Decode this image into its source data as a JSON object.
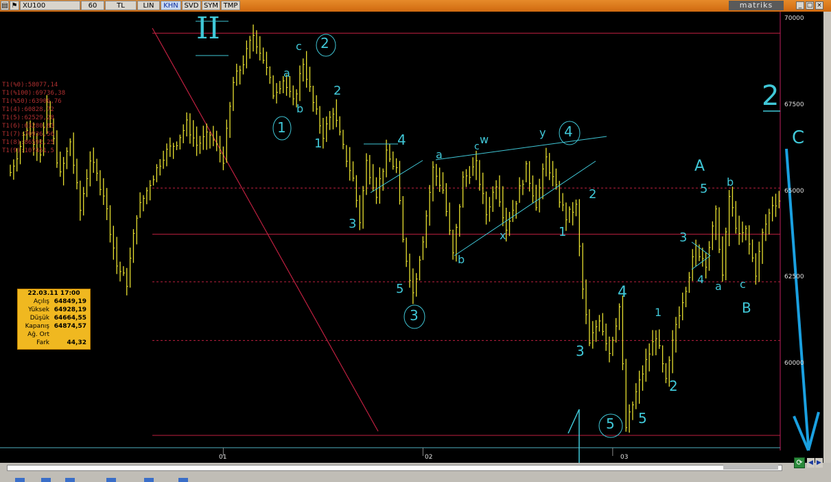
{
  "toolbar": {
    "symbol": "XU100",
    "period": "60",
    "currency": "TL",
    "scale": "LIN",
    "buttons": [
      "KHN",
      "SVD",
      "SYM",
      "TMP"
    ],
    "brand": "matriks"
  },
  "fib_levels": [
    "T1(%0):58077,14",
    "T1(%100):69736,38",
    "T1(%50):63906,76",
    "T1(4):60828,72",
    "T1(5):62529,28",
    "T1(6):63280,83",
    "T1(7):76936,56",
    "T1(8):86592,25",
    "T1(9):107451,5"
  ],
  "ohlc_box": {
    "date": "22.03.11 17:00",
    "rows": [
      {
        "label": "Açılış",
        "value": "64849,19"
      },
      {
        "label": "Yüksek",
        "value": "64928,19"
      },
      {
        "label": "Düşük",
        "value": "64664,55"
      },
      {
        "label": "Kapanış",
        "value": "64874,57"
      },
      {
        "label": "Ağ. Ort",
        "value": ""
      },
      {
        "label": "Fark",
        "value": "44,32"
      }
    ]
  },
  "chart_data": {
    "type": "bar",
    "title": "",
    "xlabel": "",
    "ylabel": "",
    "ylim": [
      57500,
      70500
    ],
    "yticks": [
      60000,
      62500,
      65000,
      67500,
      70000
    ],
    "ytick_labels": [
      "60000",
      "62500",
      "65000",
      "67500",
      "70000"
    ],
    "xticks": [
      {
        "label": "01",
        "index": 64
      },
      {
        "label": "02",
        "index": 124
      },
      {
        "label": "03",
        "index": 181
      }
    ],
    "grid": false,
    "legend": "none",
    "colors": {
      "bars": "#e8e030",
      "hline_solid": "#c02040",
      "hline_dotted": "#c02040",
      "annotation": "#40c8d8"
    },
    "horizontal_levels": [
      {
        "value": 69736,
        "style": "solid"
      },
      {
        "value": 63907,
        "style": "solid"
      },
      {
        "value": 65247,
        "style": "dotted"
      },
      {
        "value": 62529,
        "style": "dotted"
      },
      {
        "value": 60828,
        "style": "dotted"
      },
      {
        "value": 58077,
        "style": "solid"
      }
    ],
    "anchors": [
      {
        "i": 0,
        "v": 65700
      },
      {
        "i": 5,
        "v": 67000
      },
      {
        "i": 9,
        "v": 66300
      },
      {
        "i": 11,
        "v": 67600
      },
      {
        "i": 15,
        "v": 65600
      },
      {
        "i": 18,
        "v": 66600
      },
      {
        "i": 21,
        "v": 64600
      },
      {
        "i": 24,
        "v": 66100
      },
      {
        "i": 28,
        "v": 65100
      },
      {
        "i": 32,
        "v": 63000
      },
      {
        "i": 35,
        "v": 62500
      },
      {
        "i": 38,
        "v": 64500
      },
      {
        "i": 42,
        "v": 65400
      },
      {
        "i": 46,
        "v": 66200
      },
      {
        "i": 50,
        "v": 66600
      },
      {
        "i": 53,
        "v": 67100
      },
      {
        "i": 56,
        "v": 66500
      },
      {
        "i": 60,
        "v": 66800
      },
      {
        "i": 64,
        "v": 66100
      },
      {
        "i": 67,
        "v": 68300
      },
      {
        "i": 70,
        "v": 68900
      },
      {
        "i": 73,
        "v": 69700
      },
      {
        "i": 76,
        "v": 69000
      },
      {
        "i": 79,
        "v": 68000
      },
      {
        "i": 82,
        "v": 68400
      },
      {
        "i": 85,
        "v": 67700
      },
      {
        "i": 88,
        "v": 68900
      },
      {
        "i": 91,
        "v": 67700
      },
      {
        "i": 94,
        "v": 66800
      },
      {
        "i": 97,
        "v": 67500
      },
      {
        "i": 100,
        "v": 66400
      },
      {
        "i": 103,
        "v": 65500
      },
      {
        "i": 105,
        "v": 64300
      },
      {
        "i": 107,
        "v": 66000
      },
      {
        "i": 110,
        "v": 65100
      },
      {
        "i": 113,
        "v": 66200
      },
      {
        "i": 116,
        "v": 65800
      },
      {
        "i": 118,
        "v": 63700
      },
      {
        "i": 121,
        "v": 62200
      },
      {
        "i": 124,
        "v": 63800
      },
      {
        "i": 127,
        "v": 65800
      },
      {
        "i": 130,
        "v": 65200
      },
      {
        "i": 133,
        "v": 63300
      },
      {
        "i": 136,
        "v": 65500
      },
      {
        "i": 140,
        "v": 65900
      },
      {
        "i": 143,
        "v": 64500
      },
      {
        "i": 146,
        "v": 65400
      },
      {
        "i": 149,
        "v": 64100
      },
      {
        "i": 152,
        "v": 64900
      },
      {
        "i": 155,
        "v": 65800
      },
      {
        "i": 158,
        "v": 64800
      },
      {
        "i": 161,
        "v": 66100
      },
      {
        "i": 164,
        "v": 65200
      },
      {
        "i": 167,
        "v": 64400
      },
      {
        "i": 170,
        "v": 64700
      },
      {
        "i": 172,
        "v": 62300
      },
      {
        "i": 174,
        "v": 60700
      },
      {
        "i": 177,
        "v": 61500
      },
      {
        "i": 180,
        "v": 60500
      },
      {
        "i": 183,
        "v": 61800
      },
      {
        "i": 185,
        "v": 58300
      },
      {
        "i": 188,
        "v": 59300
      },
      {
        "i": 191,
        "v": 60200
      },
      {
        "i": 194,
        "v": 61000
      },
      {
        "i": 197,
        "v": 59600
      },
      {
        "i": 200,
        "v": 61300
      },
      {
        "i": 203,
        "v": 62400
      },
      {
        "i": 206,
        "v": 63500
      },
      {
        "i": 209,
        "v": 63100
      },
      {
        "i": 212,
        "v": 64500
      },
      {
        "i": 214,
        "v": 62700
      },
      {
        "i": 216,
        "v": 65000
      },
      {
        "i": 219,
        "v": 63800
      },
      {
        "i": 221,
        "v": 64000
      },
      {
        "i": 224,
        "v": 62800
      },
      {
        "i": 226,
        "v": 63900
      },
      {
        "i": 229,
        "v": 64800
      },
      {
        "i": 231,
        "v": 64900
      }
    ]
  },
  "annotations": {
    "wave_labels": [
      "II",
      "2",
      "c",
      "a",
      "b",
      "1",
      "2",
      "1",
      "4",
      "3",
      "5",
      "3",
      "a",
      "w",
      "c",
      "b",
      "x",
      "y",
      "4",
      "2",
      "1",
      "3",
      "4",
      "1",
      "2",
      "5",
      "5",
      "A",
      "5",
      "b",
      "3",
      "4",
      "a",
      "c",
      "B",
      "2",
      "C"
    ]
  }
}
